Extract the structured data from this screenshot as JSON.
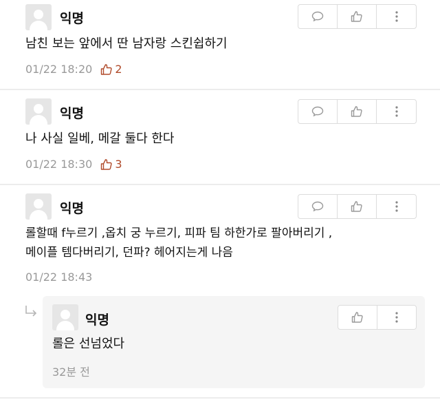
{
  "icons": {
    "comment": "speech-bubble-icon",
    "like": "thumbs-up-icon",
    "more": "vertical-dots-icon",
    "reply_arrow": "reply-arrow-icon"
  },
  "colors": {
    "like_count": "#b04a2a",
    "meta": "#999999",
    "divider": "#ececec",
    "reply_bg": "#f5f5f5"
  },
  "comments": [
    {
      "author": "익명",
      "text": "남친 보는 앞에서 딴 남자랑 스킨쉽하기",
      "time": "01/22 18:20",
      "likes": "2"
    },
    {
      "author": "익명",
      "text": "나 사실 일베, 메갈 둘다 한다",
      "time": "01/22 18:30",
      "likes": "3"
    },
    {
      "author": "익명",
      "text_line1": "롤할때 f누르기 ,옵치 궁 누르기, 피파 팀 하한가로 팔아버리기 ,",
      "text_line2": "메이플 템다버리기, 던파? 헤어지는게 나음",
      "time": "01/22 18:43"
    }
  ],
  "reply": {
    "author": "익명",
    "text": "롤은 선넘었다",
    "time": "32분 전"
  }
}
